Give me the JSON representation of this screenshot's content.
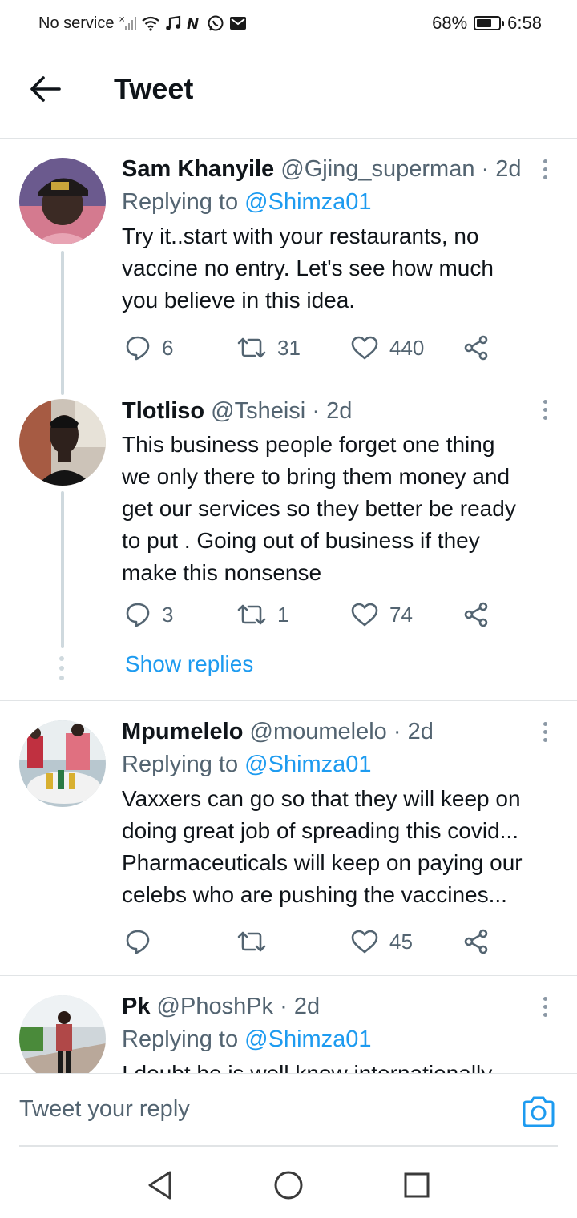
{
  "status_bar": {
    "carrier": "No service",
    "battery": "68%",
    "battery_level": 0.68,
    "time": "6:58"
  },
  "header": {
    "title": "Tweet"
  },
  "tweets": [
    {
      "name": "Sam Khanyile",
      "handle": "@Gjing_superman",
      "sep": "·",
      "time": "2d",
      "replying_prefix": "Replying to",
      "replying_to": "@Shimza01",
      "text_lines": [
        "Try it..start with your restaurants, no",
        "vaccine no entry. Let's see how much",
        "you believe in this idea."
      ],
      "replies": "6",
      "retweets": "31",
      "likes": "440"
    },
    {
      "name": "Tlotliso",
      "handle": "@Tsheisi",
      "sep": "·",
      "time": "2d",
      "text_lines": [
        "This business people forget one thing",
        "we only there to bring them money and",
        "get our services so they better be ready",
        "to put . Going out of business if they",
        "make this nonsense"
      ],
      "replies": "3",
      "retweets": "1",
      "likes": "74"
    },
    {
      "name": "Mpumelelo",
      "handle": "@moumelelo",
      "sep": "·",
      "time": "2d",
      "replying_prefix": "Replying to",
      "replying_to": "@Shimza01",
      "text_lines": [
        "Vaxxers can go so that they will keep on",
        "doing great job of spreading this covid...",
        "Pharmaceuticals will keep on paying our",
        "celebs who are pushing the vaccines..."
      ],
      "replies": "",
      "retweets": "",
      "likes": "45"
    },
    {
      "name": "Pk",
      "handle": "@PhoshPk",
      "sep": "·",
      "time": "2d",
      "replying_prefix": "Replying to",
      "replying_to": "@Shimza01",
      "text_lines": [
        "I doubt he is well know internationally"
      ]
    }
  ],
  "show_replies": "Show replies",
  "reply_bar": {
    "placeholder": "Tweet your reply"
  },
  "colors": {
    "accent": "#1d9bf0",
    "text": "#0f1419",
    "secondary": "#536471",
    "divider": "#e1e4e6"
  }
}
